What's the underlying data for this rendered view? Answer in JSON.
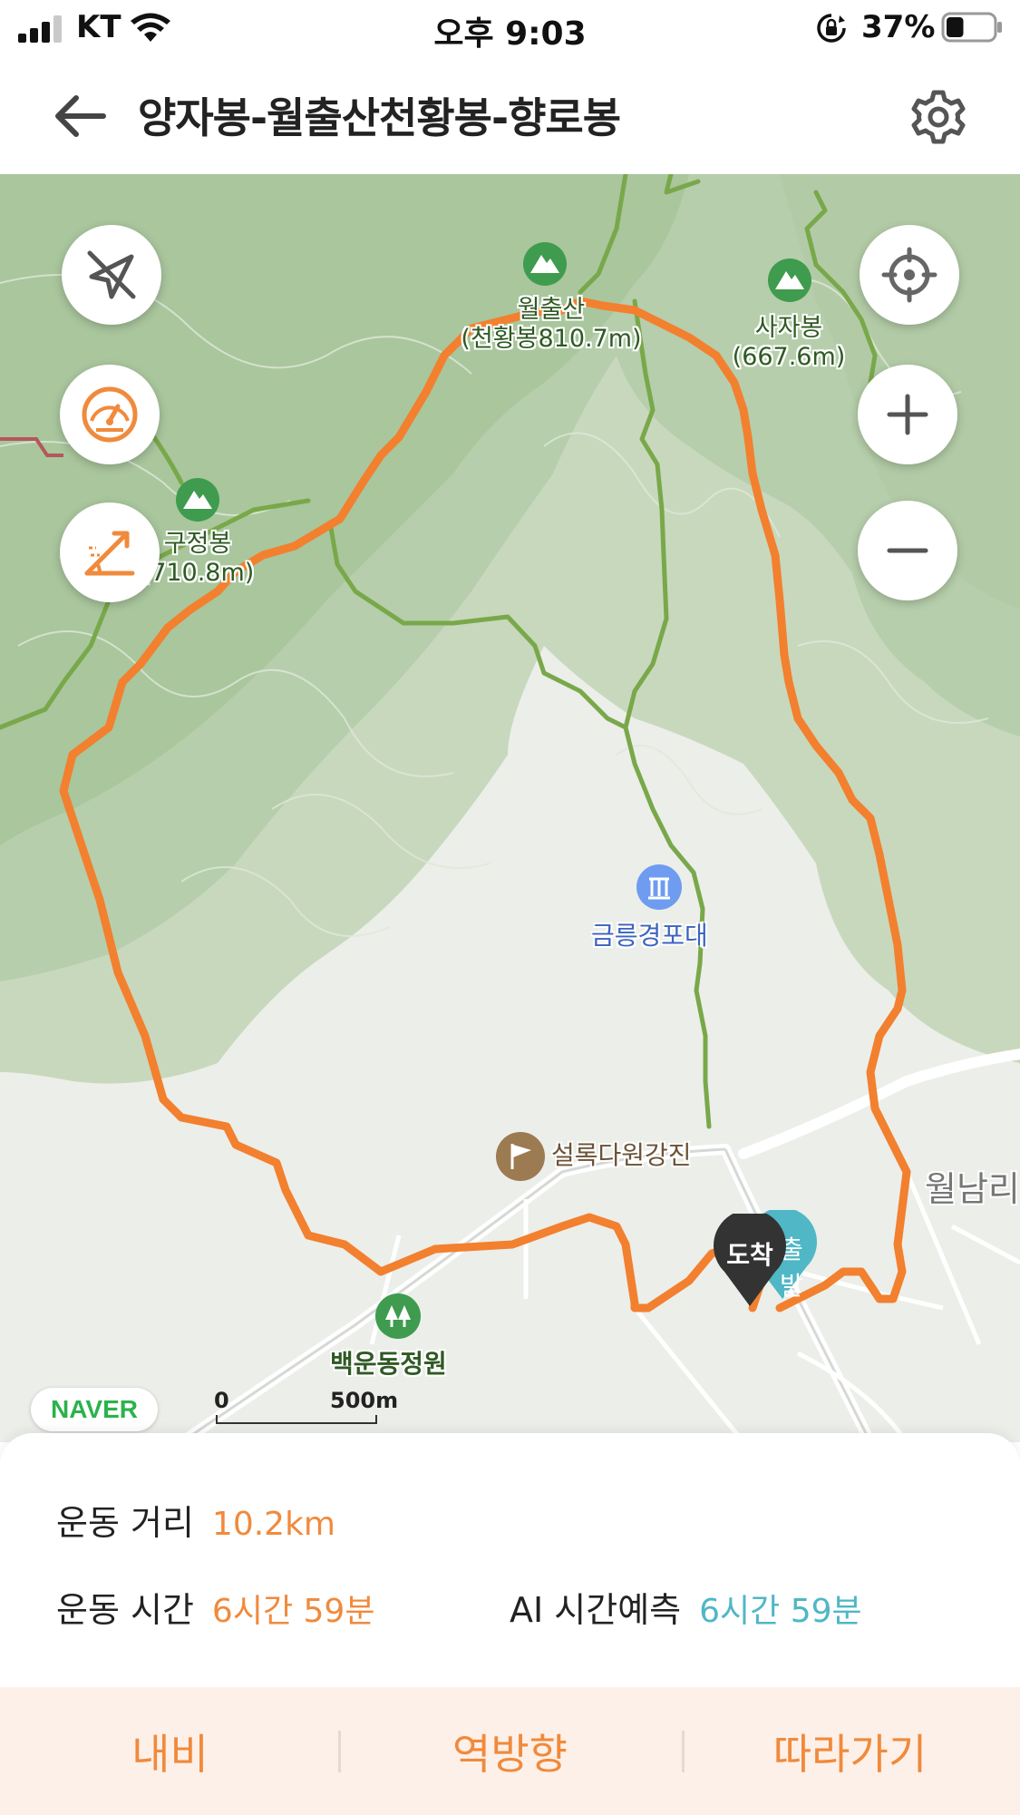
{
  "status_bar": {
    "carrier": "KT",
    "time": "오후 9:03",
    "battery_percent": "37%",
    "battery_level": 0.37
  },
  "header": {
    "title": "양자봉-월출산천황봉-향로봉",
    "back_icon": "arrow-left-icon",
    "settings_icon": "gear-icon"
  },
  "map": {
    "peaks": [
      {
        "name": "월출산",
        "height": "(천황봉810.7m)"
      },
      {
        "name": "사자봉",
        "height": "(667.6m)"
      },
      {
        "name": "구정봉",
        "height": "(710.8m)"
      }
    ],
    "pois": [
      {
        "name": "금릉경포대",
        "icon": "waterfall-icon"
      },
      {
        "name": "설록다원강진",
        "icon": "flag-icon"
      },
      {
        "name": "백운동정원",
        "icon": "tree-icon"
      }
    ],
    "region_label": "월남리",
    "markers": {
      "arrival": "도착",
      "start": "출발"
    },
    "scale": {
      "zero": "0",
      "distance": "500m"
    },
    "brand": "NAVER",
    "controls_left": [
      "compass-off-icon",
      "speedometer-icon",
      "elevation-icon"
    ],
    "controls_right": [
      "locate-icon",
      "zoom-in-icon",
      "zoom-out-icon"
    ],
    "route_color": "#f2802f"
  },
  "stats": {
    "distance_label": "운동 거리",
    "distance_value": "10.2km",
    "time_label": "운동 시간",
    "time_value": "6시간 59분",
    "ai_label": "AI 시간예측",
    "ai_value": "6시간 59분"
  },
  "actions": {
    "navigate": "내비",
    "reverse": "역방향",
    "follow": "따라가기"
  }
}
